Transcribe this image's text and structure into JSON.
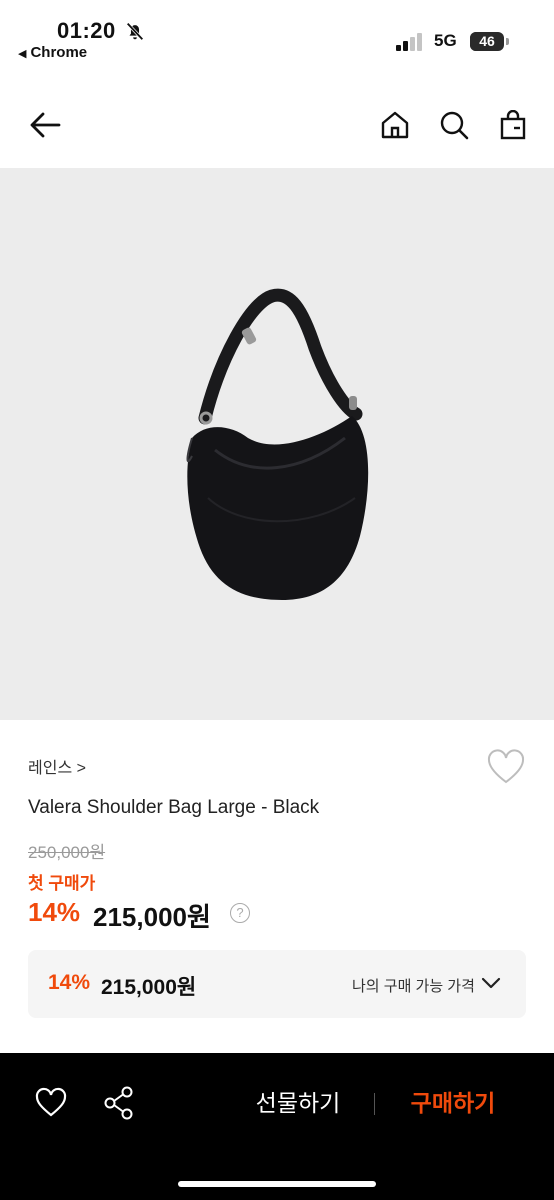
{
  "status_bar": {
    "time": "01:20",
    "back_app": "Chrome",
    "network": "5G",
    "battery": "46",
    "battery_level_pct": 46
  },
  "header": {
    "back_icon": "arrow-left-icon",
    "home_icon": "home-icon",
    "search_icon": "search-icon",
    "cart_icon": "shopping-bag-icon"
  },
  "product": {
    "image_icon": "black-shoulder-bag-image",
    "brand": "레인스 >",
    "name": "Valera Shoulder Bag Large - Black",
    "original_price": "250,000원",
    "first_purchase_label": "첫 구매가",
    "discount": "14%",
    "sale_price": "215,000원",
    "help_symbol": "?"
  },
  "price_box": {
    "discount": "14%",
    "price": "215,000원",
    "label": "나의 구매 가능 가격"
  },
  "bottom_bar": {
    "gift_label": "선물하기",
    "buy_label": "구매하기"
  },
  "colors": {
    "accent": "#f04a0c",
    "image_bg": "#ececec",
    "bottom_bar_bg": "#000000"
  }
}
